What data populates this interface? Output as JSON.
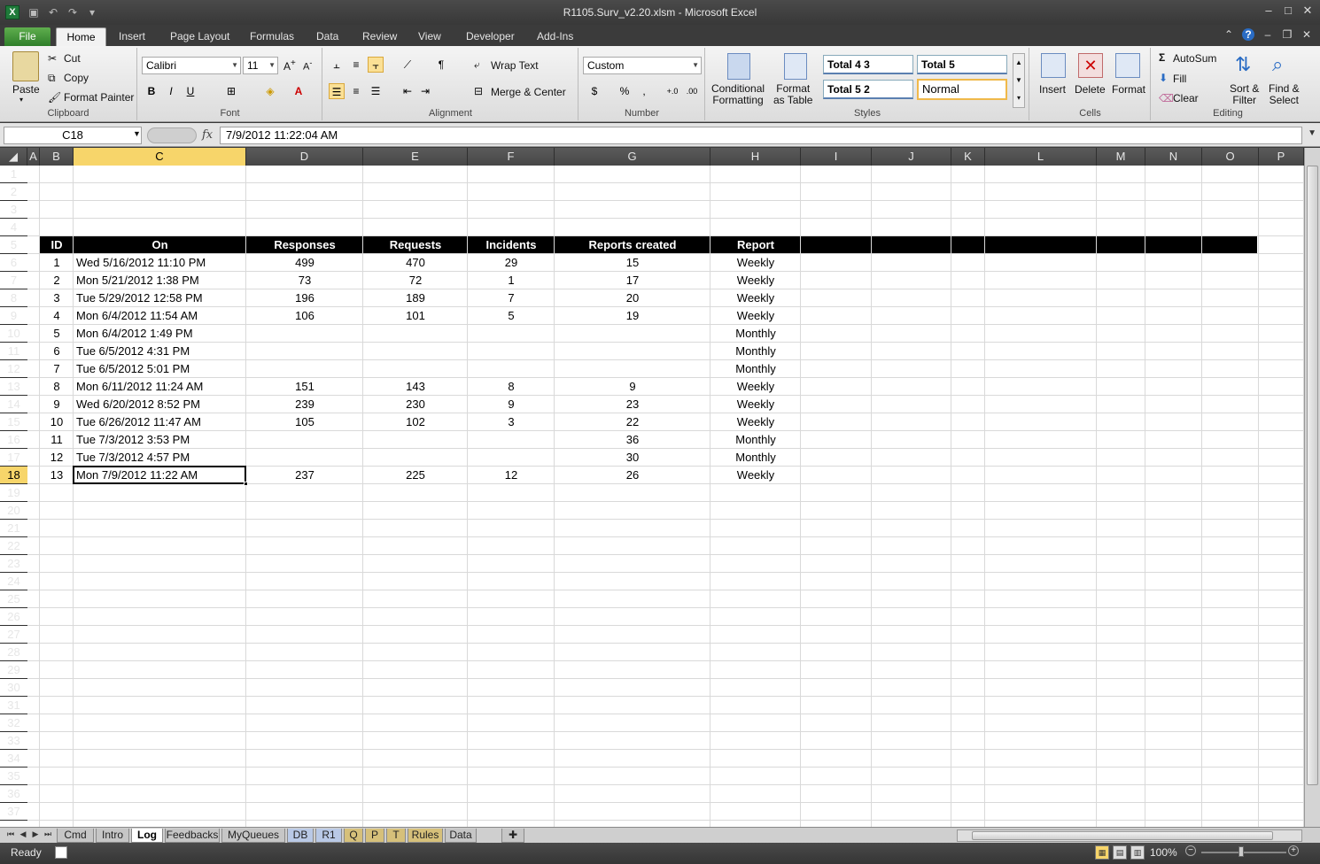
{
  "window": {
    "title": "R1105.Surv_v2.20.xlsm  -  Microsoft Excel"
  },
  "ribbon_tabs": [
    "File",
    "Home",
    "Insert",
    "Page Layout",
    "Formulas",
    "Data",
    "Review",
    "View",
    "Developer",
    "Add-Ins"
  ],
  "clipboard": {
    "paste": "Paste",
    "cut": "Cut",
    "copy": "Copy",
    "format_painter": "Format Painter",
    "label": "Clipboard"
  },
  "font": {
    "name": "Calibri",
    "size": "11",
    "label": "Font"
  },
  "alignment": {
    "wrap_text": "Wrap Text",
    "merge_center": "Merge & Center",
    "label": "Alignment"
  },
  "number": {
    "format": "Custom",
    "label": "Number",
    "currency": "$",
    "percent": "%",
    "comma": ","
  },
  "styles": {
    "s1": "Total 4 3",
    "s2": "Total 5",
    "s3": "Total 5 2",
    "s4": "Normal",
    "label": "Styles",
    "conditional": [
      "Conditional",
      "Formatting"
    ],
    "format_table": [
      "Format",
      "as Table"
    ]
  },
  "cells_group": {
    "insert": "Insert",
    "delete": "Delete",
    "format": "Format",
    "label": "Cells"
  },
  "editing": {
    "autosum": "AutoSum",
    "fill": "Fill",
    "clear": "Clear",
    "sort": [
      "Sort &",
      "Filter"
    ],
    "find": [
      "Find &",
      "Select"
    ],
    "label": "Editing"
  },
  "formula_bar": {
    "name_box": "C18",
    "fx": "fx",
    "value": "7/9/2012  11:22:04 AM"
  },
  "columns": [
    "A",
    "B",
    "C",
    "D",
    "E",
    "F",
    "G",
    "H",
    "I",
    "J",
    "K",
    "L",
    "M",
    "N",
    "O",
    "P"
  ],
  "selected_column": "C",
  "selected_row": 18,
  "rows_visible": 37,
  "table": {
    "headers": [
      "ID",
      "On",
      "Responses",
      "Requests",
      "Incidents",
      "Reports created",
      "Report"
    ],
    "rows": [
      [
        "1",
        "Wed 5/16/2012 11:10 PM",
        "499",
        "470",
        "29",
        "15",
        "Weekly"
      ],
      [
        "2",
        "Mon 5/21/2012 1:38 PM",
        "73",
        "72",
        "1",
        "17",
        "Weekly"
      ],
      [
        "3",
        "Tue 5/29/2012 12:58 PM",
        "196",
        "189",
        "7",
        "20",
        "Weekly"
      ],
      [
        "4",
        "Mon 6/4/2012 11:54 AM",
        "106",
        "101",
        "5",
        "19",
        "Weekly"
      ],
      [
        "5",
        "Mon 6/4/2012 1:49 PM",
        "",
        "",
        "",
        "",
        "Monthly"
      ],
      [
        "6",
        "Tue 6/5/2012 4:31 PM",
        "",
        "",
        "",
        "",
        "Monthly"
      ],
      [
        "7",
        "Tue 6/5/2012 5:01 PM",
        "",
        "",
        "",
        "",
        "Monthly"
      ],
      [
        "8",
        "Mon 6/11/2012 11:24 AM",
        "151",
        "143",
        "8",
        "9",
        "Weekly"
      ],
      [
        "9",
        "Wed 6/20/2012 8:52 PM",
        "239",
        "230",
        "9",
        "23",
        "Weekly"
      ],
      [
        "10",
        "Tue 6/26/2012 11:47 AM",
        "105",
        "102",
        "3",
        "22",
        "Weekly"
      ],
      [
        "11",
        "Tue 7/3/2012 3:53 PM",
        "",
        "",
        "",
        "36",
        "Monthly"
      ],
      [
        "12",
        "Tue 7/3/2012 4:57 PM",
        "",
        "",
        "",
        "30",
        "Monthly"
      ],
      [
        "13",
        "Mon 7/9/2012 11:22 AM",
        "237",
        "225",
        "12",
        "26",
        "Weekly"
      ]
    ]
  },
  "sheet_tabs": [
    "Cmd",
    "Intro",
    "Log",
    "Feedbacks",
    "MyQueues",
    "DB",
    "R1",
    "Q",
    "P",
    "T",
    "Rules",
    "Data"
  ],
  "active_sheet": "Log",
  "status": {
    "ready": "Ready",
    "zoom": "100%"
  }
}
